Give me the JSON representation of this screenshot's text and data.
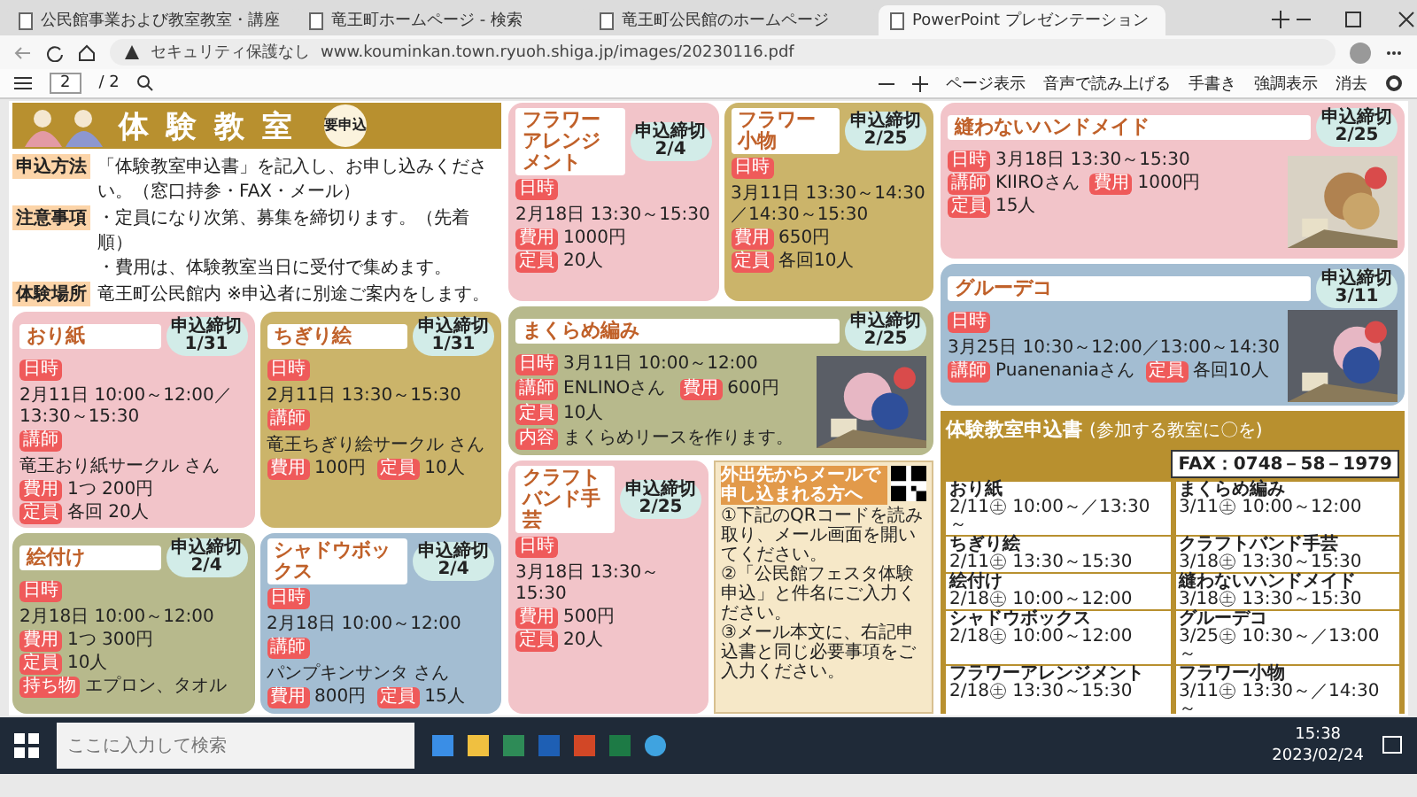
{
  "browser": {
    "tabs": [
      {
        "title": "公民館事業および教室教室・講座",
        "selected": false
      },
      {
        "title": "竜王町ホームページ - 検索",
        "selected": false
      },
      {
        "title": "竜王町公民館のホームページ",
        "selected": false
      },
      {
        "title": "PowerPoint プレゼンテーション",
        "selected": true
      }
    ],
    "security": "セキュリティ保護なし",
    "url": "www.kouminkan.town.ryuoh.shiga.jp/images/20230116.pdf"
  },
  "pdf_toolbar": {
    "page": "2",
    "total": "/ 2",
    "actions": [
      "ページ表示",
      "音声で読み上げる",
      "手書き",
      "強調表示",
      "消去"
    ]
  },
  "flyer": {
    "header": {
      "title": "体験教室",
      "badge": "要申込"
    },
    "info": [
      {
        "label": "申込方法",
        "lines": [
          "「体験教室申込書」を記入し、お申し込みください。（窓口持参・FAX・メール）"
        ]
      },
      {
        "label": "注意事項",
        "lines": [
          "・定員になり次第、募集を締切ります。（先着順）",
          "・費用は、体験教室当日に受付で集めます。"
        ]
      },
      {
        "label": "体験場所",
        "lines": [
          "竜王町公民館内 ※申込者に別途ご案内をします。"
        ]
      }
    ],
    "left_cards": [
      {
        "title": "おり紙",
        "deadline_label": "申込締切",
        "deadline": "1/31",
        "color": "#f2c4c9",
        "rows": [
          {
            "label": "日時",
            "value": "2月11日 10:00～12:00／13:30～15:30"
          },
          {
            "label": "講師",
            "value": "竜王おり紙サークル さん"
          },
          {
            "label": "費用",
            "value": "1つ 200円"
          },
          {
            "label": "定員",
            "value": "各回 20人"
          }
        ]
      },
      {
        "title": "ちぎり絵",
        "deadline_label": "申込締切",
        "deadline": "1/31",
        "color": "#cbb46a",
        "rows": [
          {
            "label": "日時",
            "value": "2月11日 13:30～15:30"
          },
          {
            "label": "講師",
            "value": "竜王ちぎり絵サークル さん"
          },
          {
            "label": "費用",
            "value": "100円"
          },
          {
            "label": "定員",
            "value": "10人"
          }
        ]
      },
      {
        "title": "絵付け",
        "deadline_label": "申込締切",
        "deadline": "2/4",
        "color": "#b7b98c",
        "rows": [
          {
            "label": "日時",
            "value": "2月18日 10:00～12:00"
          },
          {
            "label": "費用",
            "value": "1つ 300円"
          },
          {
            "label": "定員",
            "value": "10人"
          },
          {
            "label": "持ち物",
            "value": "エプロン、タオル"
          }
        ]
      },
      {
        "title": "シャドウボックス",
        "deadline_label": "申込締切",
        "deadline": "2/4",
        "color": "#a3bdd2",
        "rows": [
          {
            "label": "日時",
            "value": "2月18日 10:00～12:00"
          },
          {
            "label": "講師",
            "value": "パンプキンサンタ さん"
          },
          {
            "label": "費用",
            "value": "800円"
          },
          {
            "label": "定員",
            "value": "15人"
          }
        ]
      }
    ],
    "middle_top_cards": [
      {
        "title": "フラワーアレンジメント",
        "deadline_label": "申込締切",
        "deadline": "2/4",
        "color": "#f2c4c9",
        "rows": [
          {
            "label": "日時",
            "value": "2月18日 13:30～15:30"
          },
          {
            "label": "費用",
            "value": "1000円"
          },
          {
            "label": "定員",
            "value": "20人"
          }
        ]
      },
      {
        "title": "フラワー小物",
        "deadline_label": "申込締切",
        "deadline": "2/25",
        "color": "#cbb46a",
        "rows": [
          {
            "label": "日時",
            "value": "3月11日 13:30～14:30／14:30～15:30"
          },
          {
            "label": "費用",
            "value": "650円"
          },
          {
            "label": "定員",
            "value": "各回10人"
          }
        ]
      }
    ],
    "wide_card": {
      "title": "まくらめ編み",
      "deadline_label": "申込締切",
      "deadline": "2/25",
      "color": "#b7b98c",
      "rows": [
        {
          "label": "日時",
          "value": "3月11日 10:00～12:00"
        },
        {
          "label": "講師",
          "value": "ENLINOさん"
        },
        {
          "label": "費用",
          "value": "600円"
        },
        {
          "label": "定員",
          "value": "10人"
        },
        {
          "label": "内容",
          "value": "まくらめリースを作ります。"
        }
      ],
      "photo": {
        "kind": "picture"
      }
    },
    "kraft_card": {
      "title": "クラフトバンド手芸",
      "deadline_label": "申込締切",
      "deadline": "2/25",
      "color": "#f2c4c9",
      "rows": [
        {
          "label": "日時",
          "value": "3月18日 13:30～15:30"
        },
        {
          "label": "費用",
          "value": "500円"
        },
        {
          "label": "定員",
          "value": "20人"
        }
      ]
    },
    "mail_box": {
      "title": "外出先からメールで申し込まれる方へ",
      "steps": [
        "①下記のQRコードを読み取り、メール画面を開いてください。",
        "②「公民館フェスタ体験申込」と件名にご入力ください。",
        "③メール本文に、右記申込書と同じ必要事項をご入力ください。"
      ]
    },
    "right_cards": [
      {
        "title": "縫わないハンドメイド",
        "deadline_label": "申込締切",
        "deadline": "2/25",
        "color": "#f2c4c9",
        "rows": [
          {
            "label": "日時",
            "value": "3月18日 13:30～15:30"
          },
          {
            "label": "講師",
            "value": "KIIROさん"
          },
          {
            "label": "費用",
            "value": "1000円"
          },
          {
            "label": "定員",
            "value": "15人"
          }
        ],
        "photo": {
          "kind": "picture"
        }
      },
      {
        "title": "グルーデコ",
        "deadline_label": "申込締切",
        "deadline": "3/11",
        "color": "#a3bdd2",
        "rows": [
          {
            "label": "日時",
            "value": "3月25日 10:30～12:00／13:00～14:30"
          },
          {
            "label": "講師",
            "value": "Puanenaniaさん"
          },
          {
            "label": "定員",
            "value": "各回10人"
          }
        ],
        "photo": {
          "kind": "picture"
        }
      }
    ],
    "form": {
      "title": "体験教室申込書",
      "note": "(参加する教室に〇を)",
      "fax": "FAX：0748－58－1979",
      "entries": [
        {
          "name": "おり紙",
          "time": "2/11㊏ 10:00～／13:30～"
        },
        {
          "name": "まくらめ編み",
          "time": "3/11㊏ 10:00～12:00"
        },
        {
          "name": "ちぎり絵",
          "time": "2/11㊏ 13:30～15:30"
        },
        {
          "name": "クラフトバンド手芸",
          "time": "3/18㊏ 13:30～15:30"
        },
        {
          "name": "絵付け",
          "time": "2/18㊏ 10:00～12:00"
        },
        {
          "name": "縫わないハンドメイド",
          "time": "3/18㊏ 13:30～15:30"
        },
        {
          "name": "シャドウボックス",
          "time": "2/18㊏ 10:00～12:00"
        },
        {
          "name": "グルーデコ",
          "time": "3/25㊏ 10:30～／13:00～"
        },
        {
          "name": "フラワーアレンジメント",
          "time": "2/18㊏ 13:30～15:30"
        },
        {
          "name": "フラワー小物",
          "time": "3/11㊏ 13:30～／14:30～"
        }
      ]
    }
  },
  "taskbar": {
    "search_placeholder": "ここに入力して検索",
    "time": "15:38",
    "date": "2023/02/24"
  }
}
